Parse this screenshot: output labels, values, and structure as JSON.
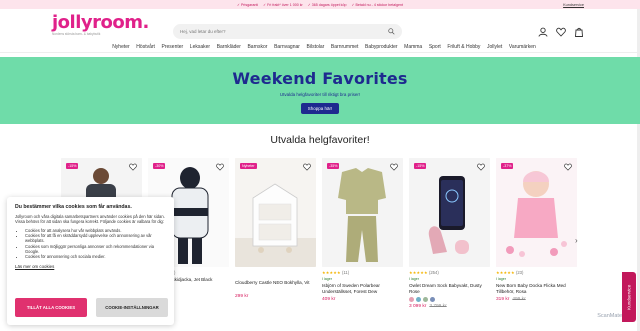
{
  "topbar": {
    "perks": [
      "✓ Prisgaranti",
      "✓ Fri frakt* över 1 000 kr",
      "✓ 365 dagars öppet köp",
      "✓ Betald nu - 4 stickor betalgent"
    ],
    "service_link": "Kundservice"
  },
  "header": {
    "logo": "jollyroom.",
    "tagline": "Nordens största barn- & babybutik",
    "search_placeholder": "Hej, vad letar du efter?"
  },
  "nav": [
    "Nyheter",
    "Höstvårt",
    "Presenter",
    "Leksaker",
    "Barnkläder",
    "Barnskor",
    "Barnvagnar",
    "Bilstolar",
    "Barnrummet",
    "Babyprodukter",
    "Mamma",
    "Sport",
    "Friluft & Hobby",
    "Jollylet",
    "Varumärken"
  ],
  "hero": {
    "title": "Weekend Favorites",
    "subtitle": "Utvalda helgfavoriter till riktigt bra priser!",
    "button": "Shoppa här!"
  },
  "section_title": "Utvalda helgfavoriter!",
  "products": [
    {
      "badge": "-15%",
      "name": "",
      "price": "",
      "old": "",
      "stars": "",
      "count": "",
      "stock": ""
    },
    {
      "badge": "-30%",
      "name": "Tiny Tröjby Skidjacka, Jet Black",
      "price": "",
      "old": "",
      "stars": "★★★★★",
      "count": "(21)",
      "stock": ""
    },
    {
      "badge": "Nyheter",
      "name": "Cloudberry Castle NEO Bokhylla, Vit",
      "price": "299 kr",
      "old": "",
      "stars": "",
      "count": "",
      "stock": ""
    },
    {
      "badge": "-35%",
      "name": "Isbjörn of Sweden Polarbear Underställsset, Forest Dew",
      "price": "409 kr",
      "old": "",
      "stars": "★★★★★",
      "count": "(11)",
      "stock": "I lager"
    },
    {
      "badge": "-15%",
      "name": "Owlet Dream Sock Babyvakt, Dusty Rose",
      "price": "3 099 kr",
      "old": "3 799 kr",
      "stars": "★★★★★",
      "count": "(254)",
      "stock": "I lager"
    },
    {
      "badge": "-37%",
      "name": "New Born Baby Docka Flicka Med Tillbehör, Rosa",
      "price": "319 kr",
      "old": "499 kr",
      "stars": "★★★★★",
      "count": "(23)",
      "stock": "I lager"
    }
  ],
  "cookie": {
    "title": "Du bestämmer vilka cookies som får användas.",
    "intro": "Jollyroom och våra digitala samarbetspartners använder cookies på den här sidan. Vissa behövs för att sidan ska fungera korrekt. Följande cookies är valbara för dig:",
    "items": [
      "Cookies för att analysera hur vår webbplats används.",
      "Cookies för att få en skräddarsydd upplevelse och annonsering av vår webbplats.",
      "Cookies som möjliggör personliga annonser och rekommendationer via Google.",
      "Cookies för annonsering och sociala medier."
    ],
    "more": "Läs mer om cookies",
    "accept": "TILLÅT ALLA COOKIES",
    "settings": "COOKIE-INSTÄLLNINGAR"
  },
  "feedback": "Kundservice",
  "watermark": "ScanMate",
  "colors": {
    "brand": "#e0218a",
    "hero_bg": "#6fdca9",
    "hero_text": "#1e2a8f",
    "price": "#d6175b"
  }
}
